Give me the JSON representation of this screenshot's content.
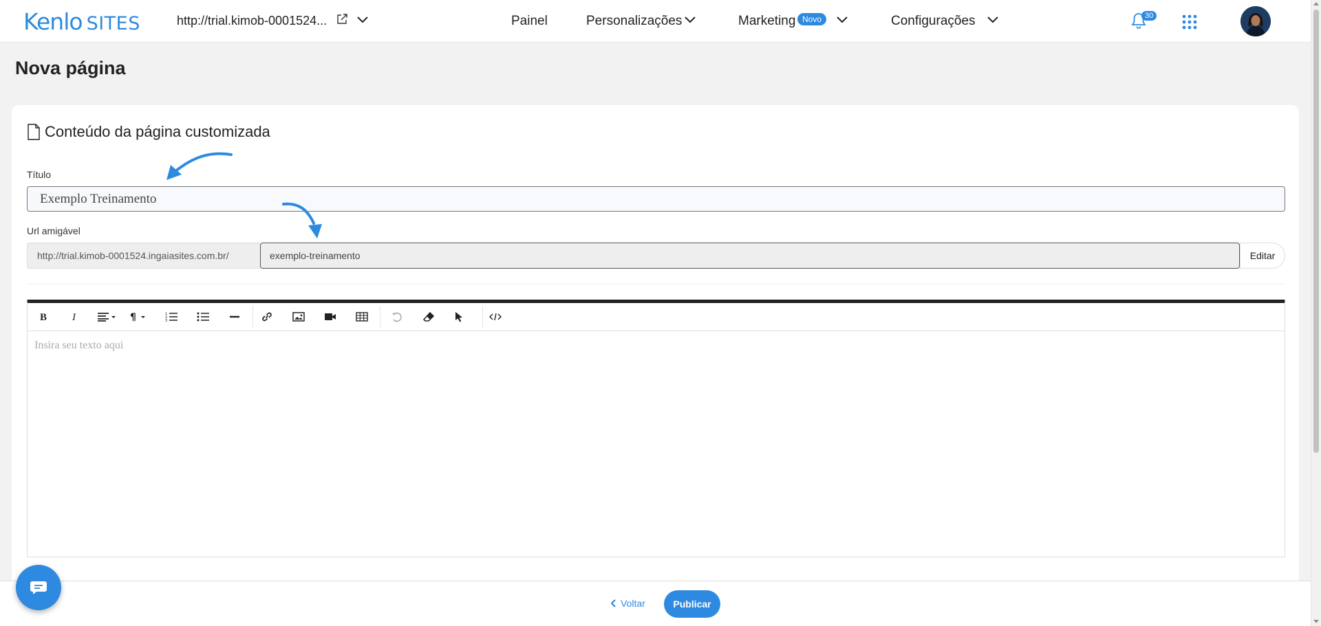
{
  "brand": {
    "name": "Kenlo",
    "product": "SITES",
    "accent": "#2d8ae0"
  },
  "header": {
    "site_url": "http://trial.kimob-0001524...",
    "nav": [
      {
        "label": "Painel"
      },
      {
        "label": "Personalizações"
      },
      {
        "label": "Marketing",
        "badge": "Novo"
      },
      {
        "label": "Configurações"
      }
    ],
    "notifications_count": "30"
  },
  "page": {
    "title": "Nova página"
  },
  "card": {
    "title": "Conteúdo da página customizada",
    "title_label": "Título",
    "title_value": "Exemplo Treinamento",
    "url_label": "Url amigável",
    "url_prefix": "http://trial.kimob-0001524.ingaiasites.com.br/",
    "url_value": "exemplo-treinamento",
    "edit_label": "Editar"
  },
  "editor": {
    "placeholder": "Insira seu texto aqui",
    "tools": [
      "bold-icon",
      "italic-icon",
      "align-icon",
      "paragraph-icon",
      "ordered-list-icon",
      "unordered-list-icon",
      "horizontal-rule-icon",
      "link-icon",
      "image-icon",
      "video-icon",
      "table-icon",
      "undo-icon",
      "eraser-icon",
      "pointer-icon",
      "code-icon"
    ]
  },
  "footer": {
    "back_label": "Voltar",
    "publish_label": "Publicar"
  }
}
